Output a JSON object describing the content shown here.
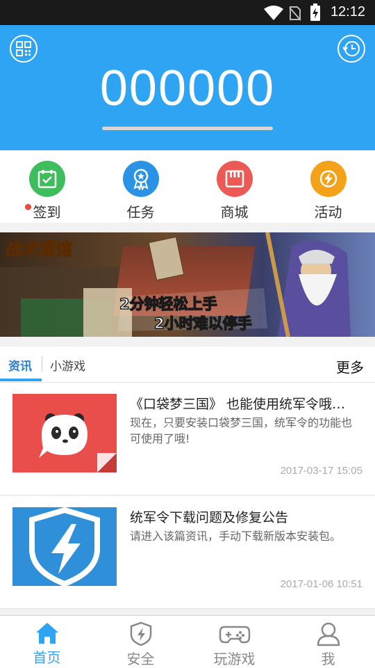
{
  "status_bar": {
    "time": "12:12"
  },
  "header": {
    "code": "000000"
  },
  "actions": [
    {
      "label": "签到",
      "color": "#3dbd5b",
      "icon": "calendar-check-icon"
    },
    {
      "label": "任务",
      "color": "#2b93e6",
      "icon": "award-badge-icon"
    },
    {
      "label": "商城",
      "color": "#ec5a56",
      "icon": "store-icon"
    },
    {
      "label": "活动",
      "color": "#f4a21a",
      "icon": "lightning-shield-icon"
    }
  ],
  "banner": {
    "game_title": "战术酒馆",
    "slogan_1": "2分钟轻松上手",
    "slogan_2": "2小时难以停手"
  },
  "tabs": {
    "items": [
      "资讯",
      "小游戏"
    ],
    "active": "资讯",
    "more": "更多"
  },
  "news": [
    {
      "title": "《口袋梦三国》 也能使用统军令哦…",
      "desc": "现在，只要安装口袋梦三国，统军令的功能也可使用了哦!",
      "date": "2017-03-17 15:05",
      "thumb_color": "#e94e4a"
    },
    {
      "title": "统军令下载问题及修复公告",
      "desc": "请进入该篇资讯，手动下载新版本安装包。",
      "date": "2017-01-06 10:51",
      "thumb_color": "#2f8fd8"
    }
  ],
  "tabbar": {
    "items": [
      {
        "label": "首页",
        "icon": "home-icon"
      },
      {
        "label": "安全",
        "icon": "shield-bolt-icon"
      },
      {
        "label": "玩游戏",
        "icon": "gamepad-icon"
      },
      {
        "label": "我",
        "icon": "user-icon"
      }
    ],
    "active": "首页"
  },
  "colors": {
    "primary": "#2ea4f2",
    "status_bar": "#1a1a1a"
  }
}
